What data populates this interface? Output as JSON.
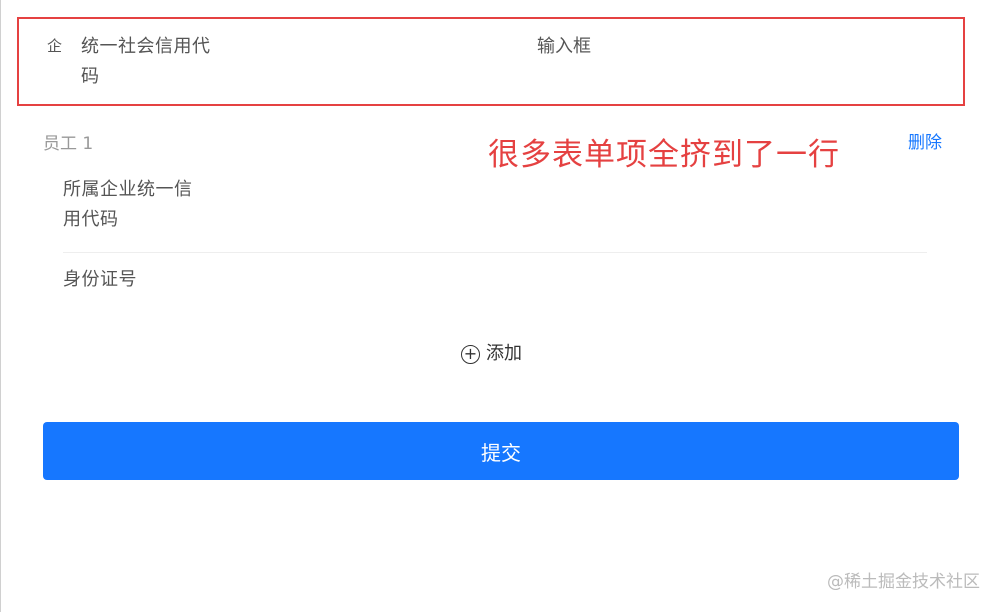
{
  "enterprise_row": {
    "icon_glyph": "企",
    "icon_name": "enterprise-icon",
    "label": "统一社会信用代码",
    "input_value": "输入框"
  },
  "employee": {
    "title": "员工 1",
    "delete_label": "删除",
    "fields": [
      {
        "label": "所属企业统一信用代码"
      },
      {
        "label": "身份证号"
      }
    ]
  },
  "annotation": {
    "text": "很多表单项全挤到了一行",
    "color": "#e54141"
  },
  "add_button": {
    "label": "添加",
    "icon_glyph": "+"
  },
  "submit_button": {
    "label": "提交"
  },
  "watermark": "@稀土掘金技术社区",
  "colors": {
    "primary": "#1677ff",
    "annotation_red": "#e54141"
  }
}
